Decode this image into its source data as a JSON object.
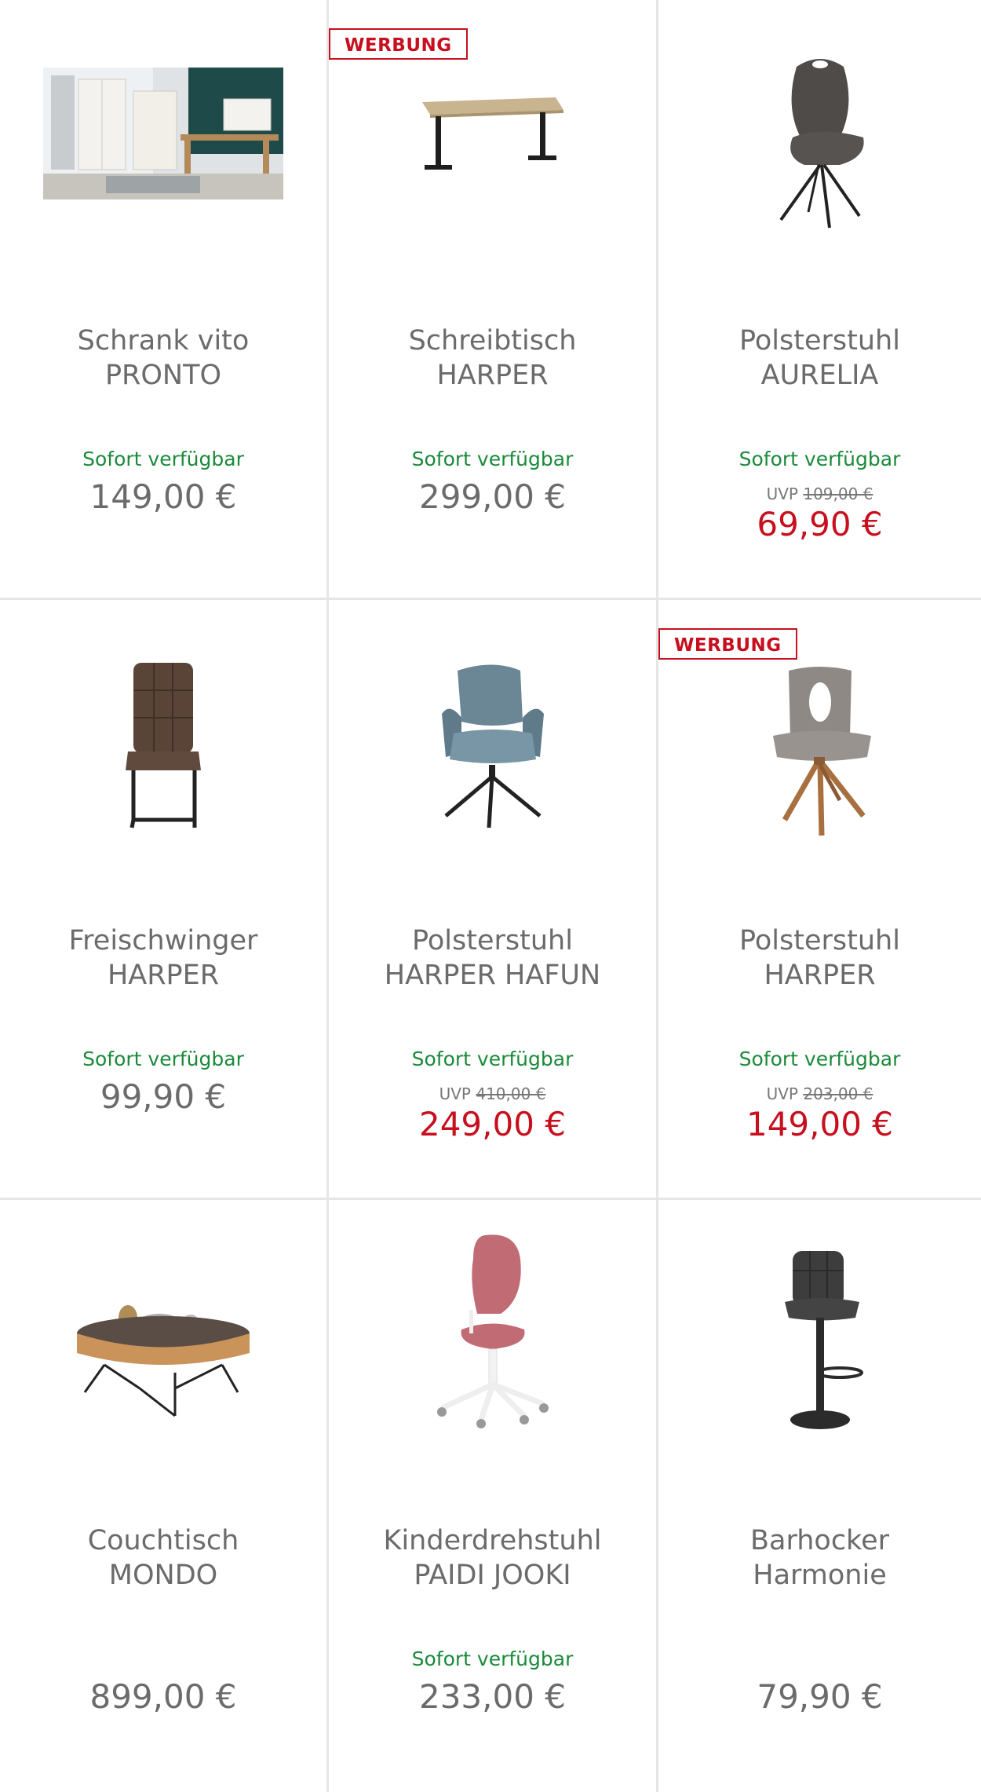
{
  "colors": {
    "sale_red": "#c80f1e",
    "available_green": "#1a8a3a",
    "text_gray": "#6b6b6b",
    "divider": "#e6e6e6"
  },
  "products": [
    {
      "badge": "",
      "image_icon": "office-room-photo",
      "name_line1": "Schrank vito",
      "name_line2": "PRONTO",
      "availability": "Sofort verfügbar",
      "uvp_label": "",
      "uvp_price": "",
      "price": "149,00 €",
      "sale": false
    },
    {
      "badge": "WERBUNG",
      "image_icon": "desk-icon",
      "name_line1": "Schreibtisch",
      "name_line2": "HARPER",
      "availability": "Sofort verfügbar",
      "uvp_label": "",
      "uvp_price": "",
      "price": "299,00 €",
      "sale": false
    },
    {
      "badge": "",
      "image_icon": "upholstered-chair-icon",
      "name_line1": "Polsterstuhl",
      "name_line2": "AURELIA",
      "availability": "Sofort verfügbar",
      "uvp_label": "UVP",
      "uvp_price": "109,00 €",
      "price": "69,90 €",
      "sale": true
    },
    {
      "badge": "",
      "image_icon": "cantilever-chair-icon",
      "name_line1": "Freischwinger",
      "name_line2": "HARPER",
      "availability": "Sofort verfügbar",
      "uvp_label": "",
      "uvp_price": "",
      "price": "99,90 €",
      "sale": false
    },
    {
      "badge": "",
      "image_icon": "armchair-icon",
      "name_line1": "Polsterstuhl",
      "name_line2": "HARPER HAFUN",
      "availability": "Sofort verfügbar",
      "uvp_label": "UVP",
      "uvp_price": "410,00 €",
      "price": "249,00 €",
      "sale": true
    },
    {
      "badge": "WERBUNG",
      "image_icon": "wooden-leg-chair-icon",
      "name_line1": "Polsterstuhl",
      "name_line2": "HARPER",
      "availability": "Sofort verfügbar",
      "uvp_label": "UVP",
      "uvp_price": "203,00 €",
      "price": "149,00 €",
      "sale": true
    },
    {
      "badge": "",
      "image_icon": "coffee-table-icon",
      "name_line1": "Couchtisch",
      "name_line2": "MONDO",
      "availability": "",
      "uvp_label": "",
      "uvp_price": "",
      "price": "899,00 €",
      "sale": false
    },
    {
      "badge": "",
      "image_icon": "kids-swivel-chair-icon",
      "name_line1": "Kinderdrehstuhl",
      "name_line2": "PAIDI JOOKI",
      "availability": "Sofort verfügbar",
      "uvp_label": "",
      "uvp_price": "",
      "price": "233,00 €",
      "sale": false
    },
    {
      "badge": "",
      "image_icon": "bar-stool-icon",
      "name_line1": "Barhocker",
      "name_line2": "Harmonie",
      "availability": "",
      "uvp_label": "",
      "uvp_price": "",
      "price": "79,90 €",
      "sale": false
    }
  ]
}
